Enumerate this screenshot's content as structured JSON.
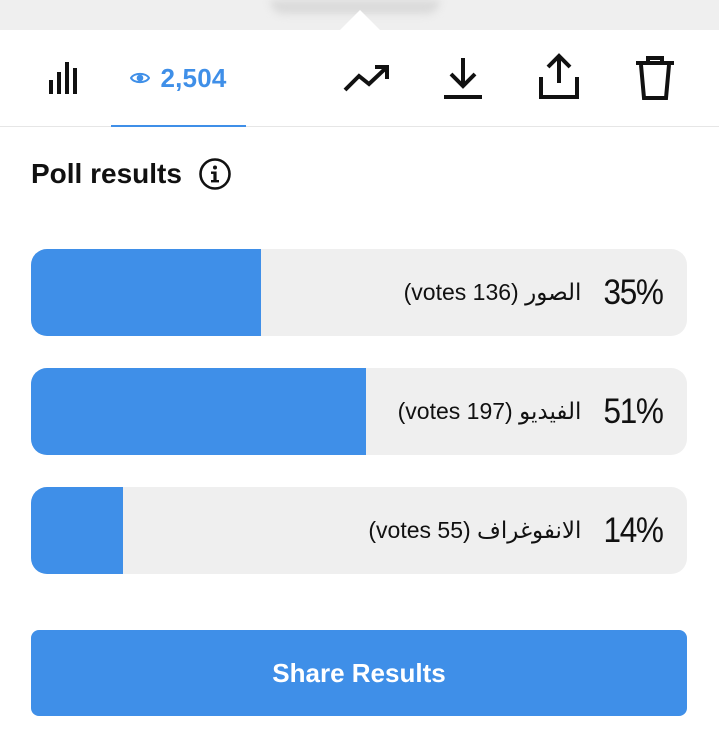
{
  "toolbar": {
    "insights_icon": "bar-chart-icon",
    "views": {
      "icon": "eye-icon",
      "count": "2,504"
    },
    "boost_icon": "trending-up-icon",
    "download_icon": "download-icon",
    "share_icon": "share-upload-icon",
    "delete_icon": "trash-icon"
  },
  "poll": {
    "title": "Poll results",
    "info_icon": "info-icon",
    "options": [
      {
        "name": "الصور (136 votes)",
        "percent_label": "35%",
        "percent": 35
      },
      {
        "name": "الفيديو (197 votes)",
        "percent_label": "51%",
        "percent": 51
      },
      {
        "name": "الانفوغراف (55 votes)",
        "percent_label": "14%",
        "percent": 14
      }
    ]
  },
  "share_button": {
    "label": "Share Results"
  },
  "colors": {
    "accent": "#3f8fe8",
    "track": "#efefef",
    "text": "#111111"
  }
}
